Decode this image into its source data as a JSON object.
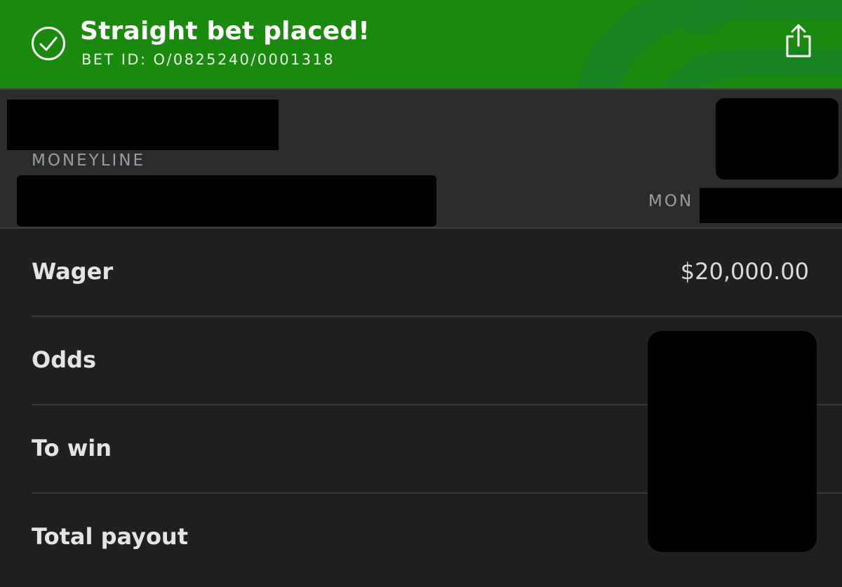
{
  "banner": {
    "title": "Straight bet placed!",
    "bet_id": "BET ID: O/0825240/0001318",
    "color": "#1a8a0e",
    "icons": [
      "check-circle-icon",
      "share-icon"
    ]
  },
  "summary": {
    "market_label": "MONEYLINE",
    "date_prefix": "MON"
  },
  "details": {
    "rows": [
      {
        "label": "Wager",
        "value": "$20,000.00"
      },
      {
        "label": "Odds",
        "value": ""
      },
      {
        "label": "To win",
        "value": ""
      },
      {
        "label": "Total payout",
        "value": ""
      }
    ]
  }
}
